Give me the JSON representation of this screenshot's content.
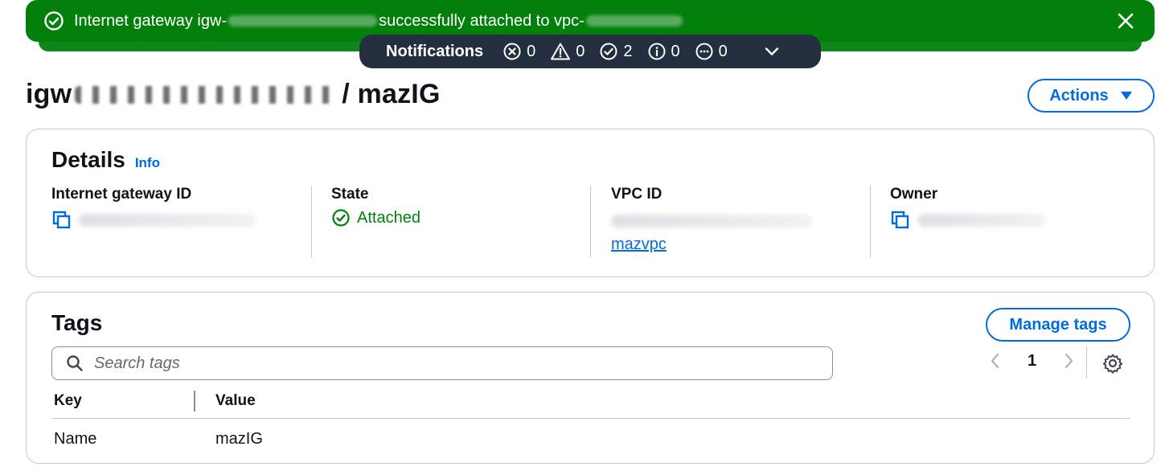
{
  "flash": {
    "message_prefix": "Internet gateway igw-",
    "message_middle": " successfully attached to vpc-",
    "status_color": "#037f0c",
    "icon": "success-circle-icon"
  },
  "notifications": {
    "title": "Notifications",
    "errors": "0",
    "warnings": "0",
    "success": "2",
    "info": "0",
    "in_progress": "0"
  },
  "header": {
    "title_prefix": "igw",
    "title_suffix": "/ mazIG",
    "actions_label": "Actions"
  },
  "details": {
    "title": "Details",
    "info_label": "Info",
    "columns": {
      "igw_label": "Internet gateway ID",
      "state_label": "State",
      "state_value": "Attached",
      "vpc_label": "VPC ID",
      "vpc_link": "mazvpc",
      "owner_label": "Owner"
    }
  },
  "tags": {
    "title": "Tags",
    "manage_label": "Manage tags",
    "search_placeholder": "Search tags",
    "page": "1",
    "headers": [
      "Key",
      "Value"
    ],
    "rows": [
      {
        "key": "Name",
        "value": "mazIG"
      }
    ]
  },
  "colors": {
    "accent": "#006ce0",
    "success": "#037f0c",
    "dark": "#232f3e"
  }
}
